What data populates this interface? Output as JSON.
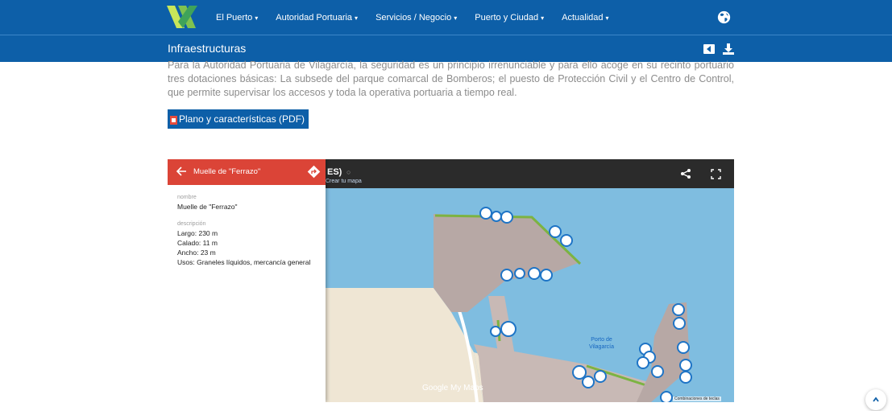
{
  "nav": {
    "items": [
      {
        "label": "El Puerto"
      },
      {
        "label": "Autoridad Portuaria"
      },
      {
        "label": "Servicios / Negocio"
      },
      {
        "label": "Puerto y Ciudad"
      },
      {
        "label": "Actualidad"
      }
    ],
    "caret": "▾",
    "globe_icon": "globe-icon"
  },
  "subheader": {
    "title": "Infraestructuras",
    "icons": [
      "back-icon",
      "download-icon"
    ]
  },
  "content": {
    "paragraph": "Para la Autoridad Portuaria de Vilagarcía, la seguridad es un principio irrenunciable y para ello acoge en su recinto portuario tres dotaciones básicas: La subsede del parque comarcal de Bomberos; el puesto de Protección Civil y el Centro de Control, que permite supervisar los accesos y toda la operativa portuaria a tiempo real.",
    "pdf_button": "Plano y características (PDF)"
  },
  "map": {
    "title": "ES)",
    "dot": "○",
    "subtitle": "Crear tu mapa",
    "panel": {
      "title": "Muelle de \"Ferrazo\"",
      "name_label": "nombre",
      "name_value": "Muelle de \"Ferrazo\"",
      "desc_label": "descripción",
      "desc_lines": [
        "Largo: 230 m",
        "Calado: 11 m",
        "Ancho: 23 m",
        "Usos: Graneles líquidos, mercancía general"
      ]
    },
    "place_label_1": "Porto de",
    "place_label_2": "Vilagarcía",
    "google_brand": "Google My Maps",
    "attribution": "Combinaciones de teclas",
    "colors": {
      "water": "#7fbde0",
      "pier": "#b7a8a5",
      "land": "#efe6d4",
      "green": "#7cb342",
      "header": "#0d5fa8",
      "panel_head": "#db4437"
    }
  },
  "scroll_top_icon": "chevron-up-icon"
}
